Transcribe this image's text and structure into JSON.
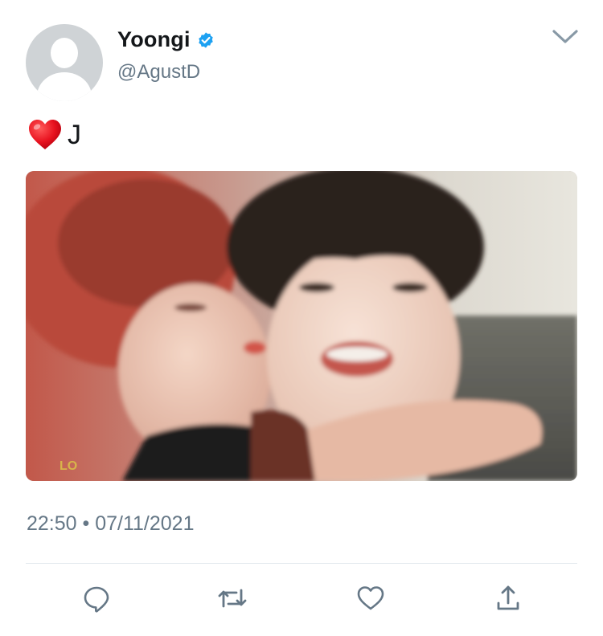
{
  "author": {
    "display_name": "Yoongi",
    "handle": "@AgustD",
    "verified": true
  },
  "tweet": {
    "emoji": "heart-emoji",
    "text": "J",
    "timestamp": "22:50 • 07/11/2021"
  },
  "media": {
    "type": "photo",
    "watermark": "LO"
  },
  "icons": {
    "avatar": "default-avatar-icon",
    "verified": "verified-badge-icon",
    "menu": "chevron-down-icon",
    "reply": "reply-icon",
    "retweet": "retweet-icon",
    "like": "heart-outline-icon",
    "share": "share-icon"
  },
  "colors": {
    "accent": "#1da1f2",
    "secondary_text": "#657786",
    "divider": "#e1e8ed",
    "icon": "#657786"
  }
}
